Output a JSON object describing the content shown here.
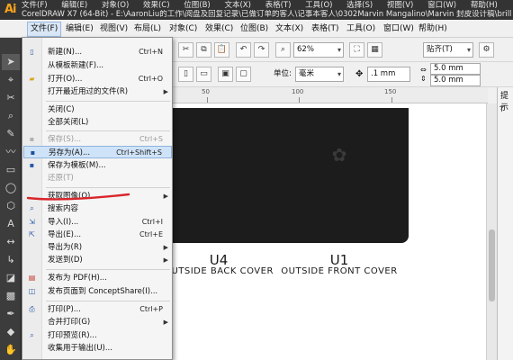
{
  "titlebar": {
    "menus": [
      "文件(F)",
      "编辑(E)",
      "对象(O)",
      "效果(C)",
      "位图(B)",
      "文本(X)",
      "表格(T)",
      "工具(O)",
      "选择(S)",
      "视图(V)",
      "窗口(W)",
      "帮助(H)"
    ],
    "title": "CorelDRAW X7 (64-Bit) - E:\\AaronLiu的工作\\阅盘及回复记录\\已做订单的客人\\记事本客人\\0302Marvin Mangalino\\Marvin 封皮设计稿\\brilli_guest_r"
  },
  "menubar": {
    "items": [
      "文件(F)",
      "编辑(E)",
      "视图(V)",
      "布局(L)",
      "对象(C)",
      "效果(C)",
      "位图(B)",
      "文本(X)",
      "表格(T)",
      "工具(O)",
      "窗口(W)",
      "帮助(H)"
    ]
  },
  "propbar": {
    "zoom": "62%",
    "paste": "贴齐(T)",
    "unit_label": "单位:",
    "unit": "毫米",
    "nudge": ".1 mm",
    "dup_x": "5.0 mm",
    "dup_y": "5.0 mm"
  },
  "ruler": {
    "labels": [
      "50",
      "100",
      "150"
    ]
  },
  "docker": {
    "title": "提示",
    "label": "T"
  },
  "canvas": {
    "u4": "U4",
    "u4_caption": "OUTSIDE BACK COVER",
    "u1": "U1",
    "u1_caption": "OUTSIDE FRONT COVER"
  },
  "file_menu": {
    "items": [
      {
        "icon": "new-doc-icon",
        "label": "新建(N)...",
        "shortcut": "Ctrl+N",
        "arrow": ""
      },
      {
        "icon": "",
        "label": "从模板新建(F)...",
        "shortcut": "",
        "arrow": ""
      },
      {
        "icon": "open-folder-icon",
        "label": "打开(O)...",
        "shortcut": "Ctrl+O",
        "arrow": ""
      },
      {
        "icon": "",
        "label": "打开最近用过的文件(R)",
        "shortcut": "",
        "arrow": "▶"
      },
      {
        "icon": "",
        "label": "关闭(C)",
        "shortcut": "",
        "arrow": ""
      },
      {
        "icon": "",
        "label": "全部关闭(L)",
        "shortcut": "",
        "arrow": ""
      },
      {
        "icon": "save-icon",
        "label": "保存(S)...",
        "shortcut": "Ctrl+S",
        "arrow": ""
      },
      {
        "icon": "save-as-icon",
        "label": "另存为(A)...",
        "shortcut": "Ctrl+Shift+S",
        "arrow": ""
      },
      {
        "icon": "save-template-icon",
        "label": "保存为模板(M)...",
        "shortcut": "",
        "arrow": ""
      },
      {
        "icon": "",
        "label": "还原(T)",
        "shortcut": "",
        "arrow": ""
      },
      {
        "icon": "",
        "label": "获取图像(Q)",
        "shortcut": "",
        "arrow": "▶"
      },
      {
        "icon": "search-content-icon",
        "label": "搜索内容",
        "shortcut": "",
        "arrow": ""
      },
      {
        "icon": "import-icon",
        "label": "导入(I)...",
        "shortcut": "Ctrl+I",
        "arrow": ""
      },
      {
        "icon": "export-icon",
        "label": "导出(E)...",
        "shortcut": "Ctrl+E",
        "arrow": ""
      },
      {
        "icon": "",
        "label": "导出为(R)",
        "shortcut": "",
        "arrow": "▶"
      },
      {
        "icon": "",
        "label": "发送到(D)",
        "shortcut": "",
        "arrow": "▶"
      },
      {
        "icon": "pdf-icon",
        "label": "发布为 PDF(H)...",
        "shortcut": "",
        "arrow": ""
      },
      {
        "icon": "conceptshare-icon",
        "label": "发布页面到 ConceptShare(I)...",
        "shortcut": "",
        "arrow": ""
      },
      {
        "icon": "print-icon",
        "label": "打印(P)...",
        "shortcut": "Ctrl+P",
        "arrow": ""
      },
      {
        "icon": "",
        "label": "合并打印(G)",
        "shortcut": "",
        "arrow": "▶"
      },
      {
        "icon": "print-preview-icon",
        "label": "打印预览(R)...",
        "shortcut": "",
        "arrow": ""
      },
      {
        "icon": "",
        "label": "收集用于输出(U)...",
        "shortcut": "",
        "arrow": ""
      }
    ]
  },
  "colors": {
    "highlight": "#cfe3f8",
    "annotation": "#d9262c",
    "artboard": "#1c1c1c"
  }
}
